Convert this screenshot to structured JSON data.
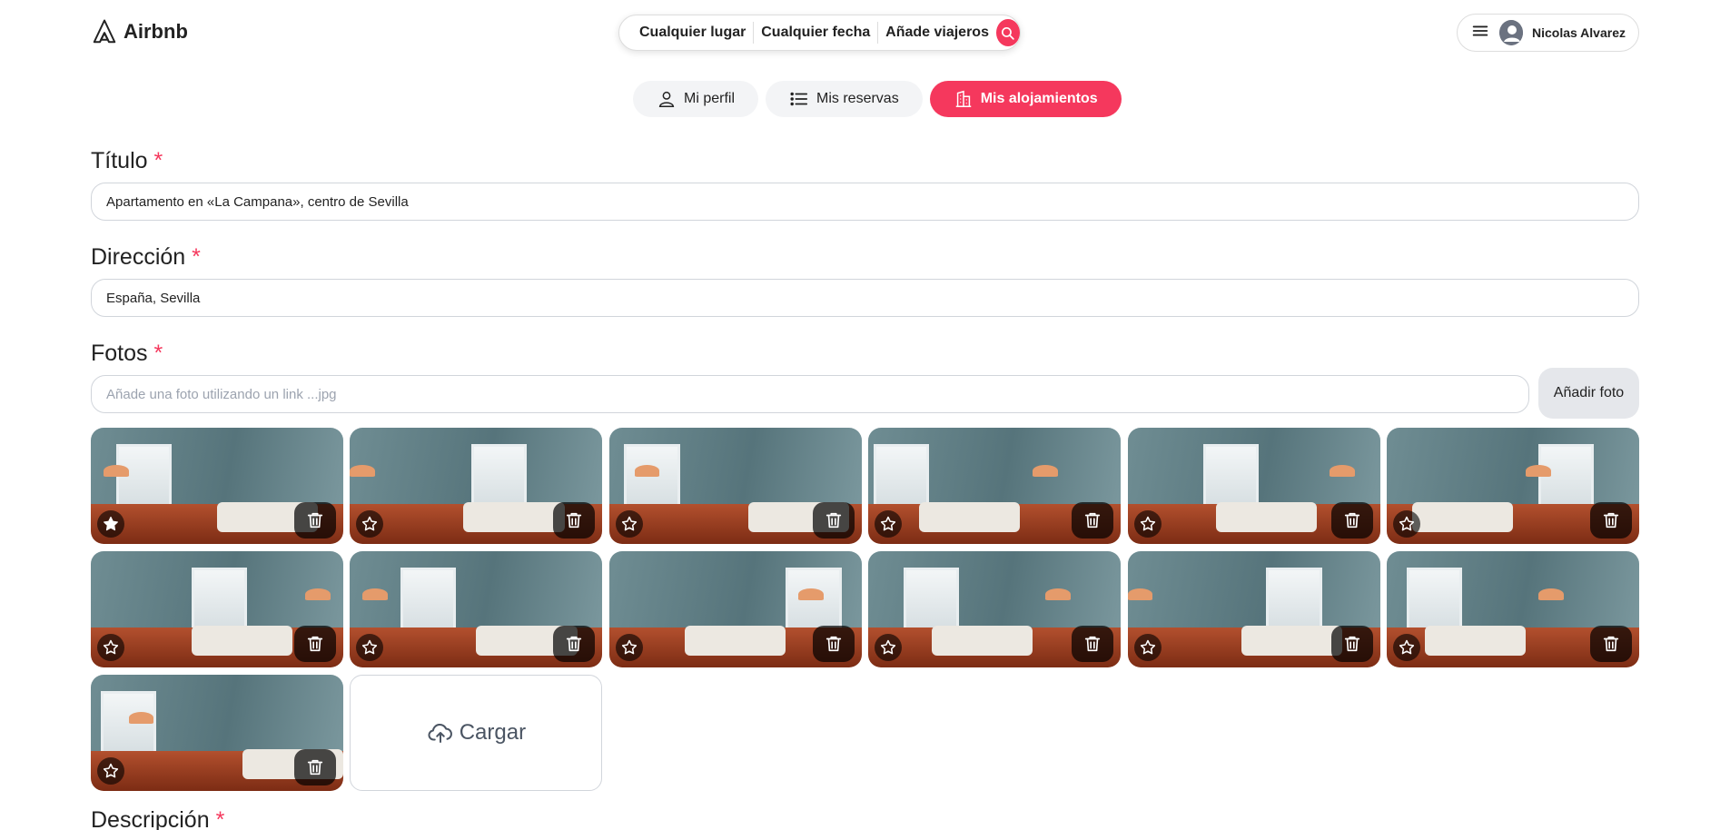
{
  "header": {
    "logo_text": "Airbnb",
    "search": {
      "place": "Cualquier lugar",
      "date": "Cualquier fecha",
      "guests": "Añade viajeros"
    },
    "user_name": "Nicolas Alvarez"
  },
  "tabs": [
    {
      "label": "Mi perfil",
      "active": false
    },
    {
      "label": "Mis reservas",
      "active": false
    },
    {
      "label": "Mis alojamientos",
      "active": true
    }
  ],
  "form": {
    "title_label": "Título",
    "title_value": "Apartamento en «La Campana», centro de Sevilla",
    "address_label": "Dirección",
    "address_value": "España, Sevilla",
    "photos_label": "Fotos",
    "photo_link_placeholder": "Añade una foto utilizando un link ...jpg",
    "add_photo_button": "Añadir foto",
    "upload_label": "Cargar",
    "description_label": "Descripción",
    "required_mark": "*"
  },
  "photos": [
    {
      "name": "photo-1",
      "featured": true
    },
    {
      "name": "photo-2",
      "featured": false
    },
    {
      "name": "photo-3",
      "featured": false
    },
    {
      "name": "photo-4",
      "featured": false
    },
    {
      "name": "photo-5",
      "featured": false
    },
    {
      "name": "photo-6",
      "featured": false
    },
    {
      "name": "photo-7",
      "featured": false
    },
    {
      "name": "photo-8",
      "featured": false
    },
    {
      "name": "photo-9",
      "featured": false
    },
    {
      "name": "photo-10",
      "featured": false
    },
    {
      "name": "photo-11",
      "featured": false
    },
    {
      "name": "photo-12",
      "featured": false
    },
    {
      "name": "photo-13",
      "featured": false
    }
  ],
  "colors": {
    "accent": "#F5385D",
    "border": "#d1d5db"
  }
}
